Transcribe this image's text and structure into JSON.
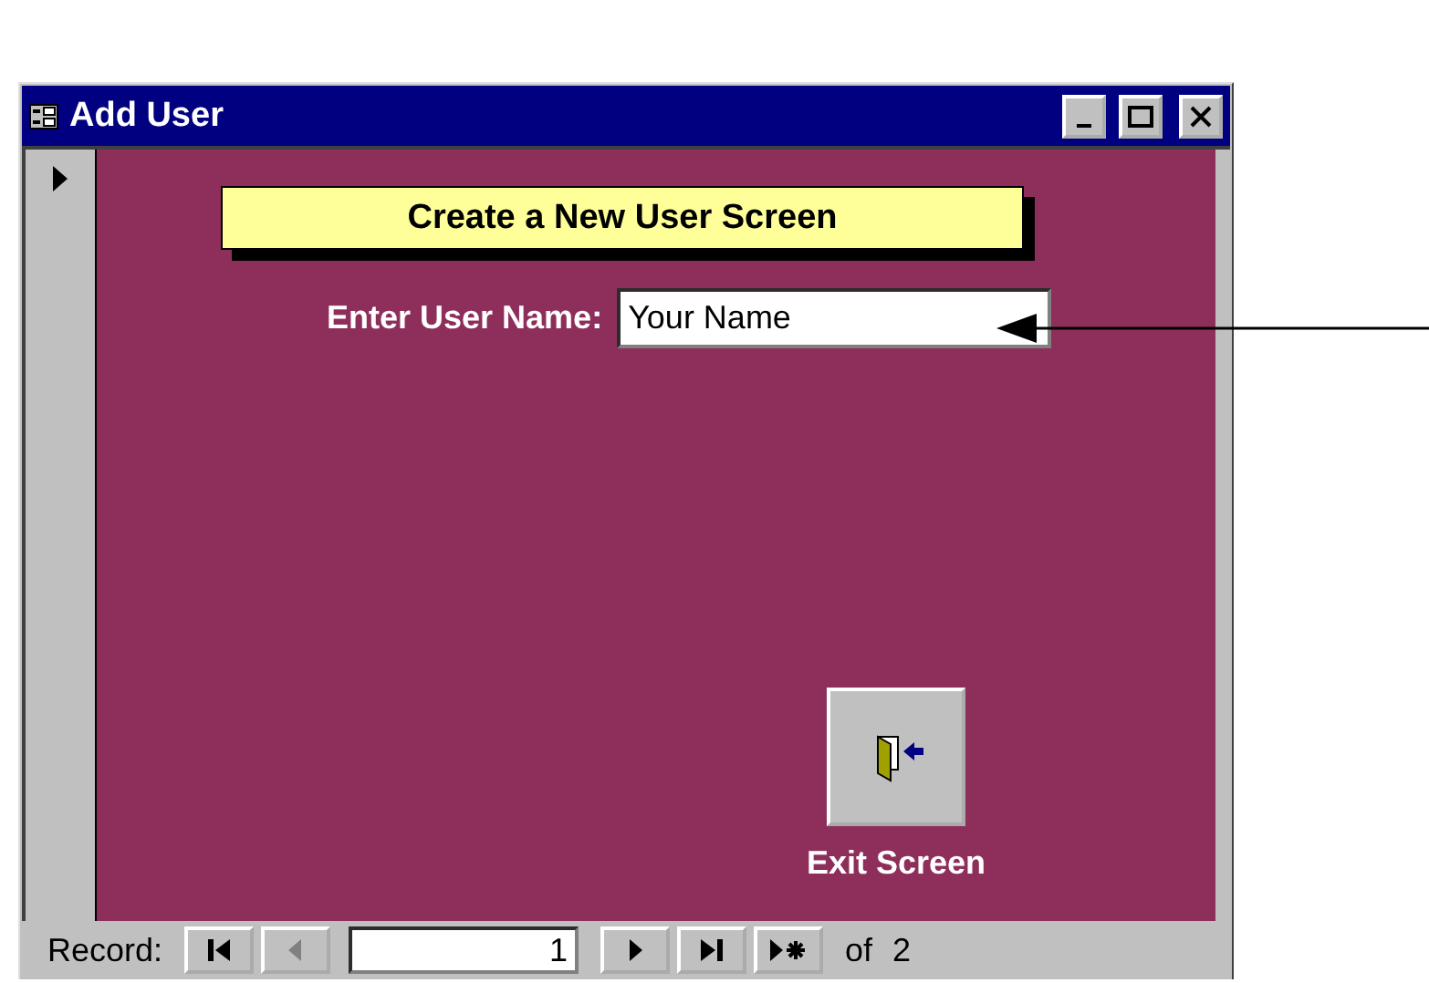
{
  "window": {
    "title": "Add User"
  },
  "form": {
    "heading": "Create a New User Screen",
    "field_label": "Enter User Name:",
    "field_value": "Your Name",
    "exit_button": "Exit Screen"
  },
  "navigation": {
    "label": "Record:",
    "current": "1",
    "total": "of 2",
    "buttons": [
      {
        "kind": "first",
        "disabled": false
      },
      {
        "kind": "prev",
        "disabled": true
      },
      {
        "kind": "next",
        "disabled": false
      },
      {
        "kind": "last",
        "disabled": false
      },
      {
        "kind": "new",
        "disabled": false
      }
    ]
  }
}
